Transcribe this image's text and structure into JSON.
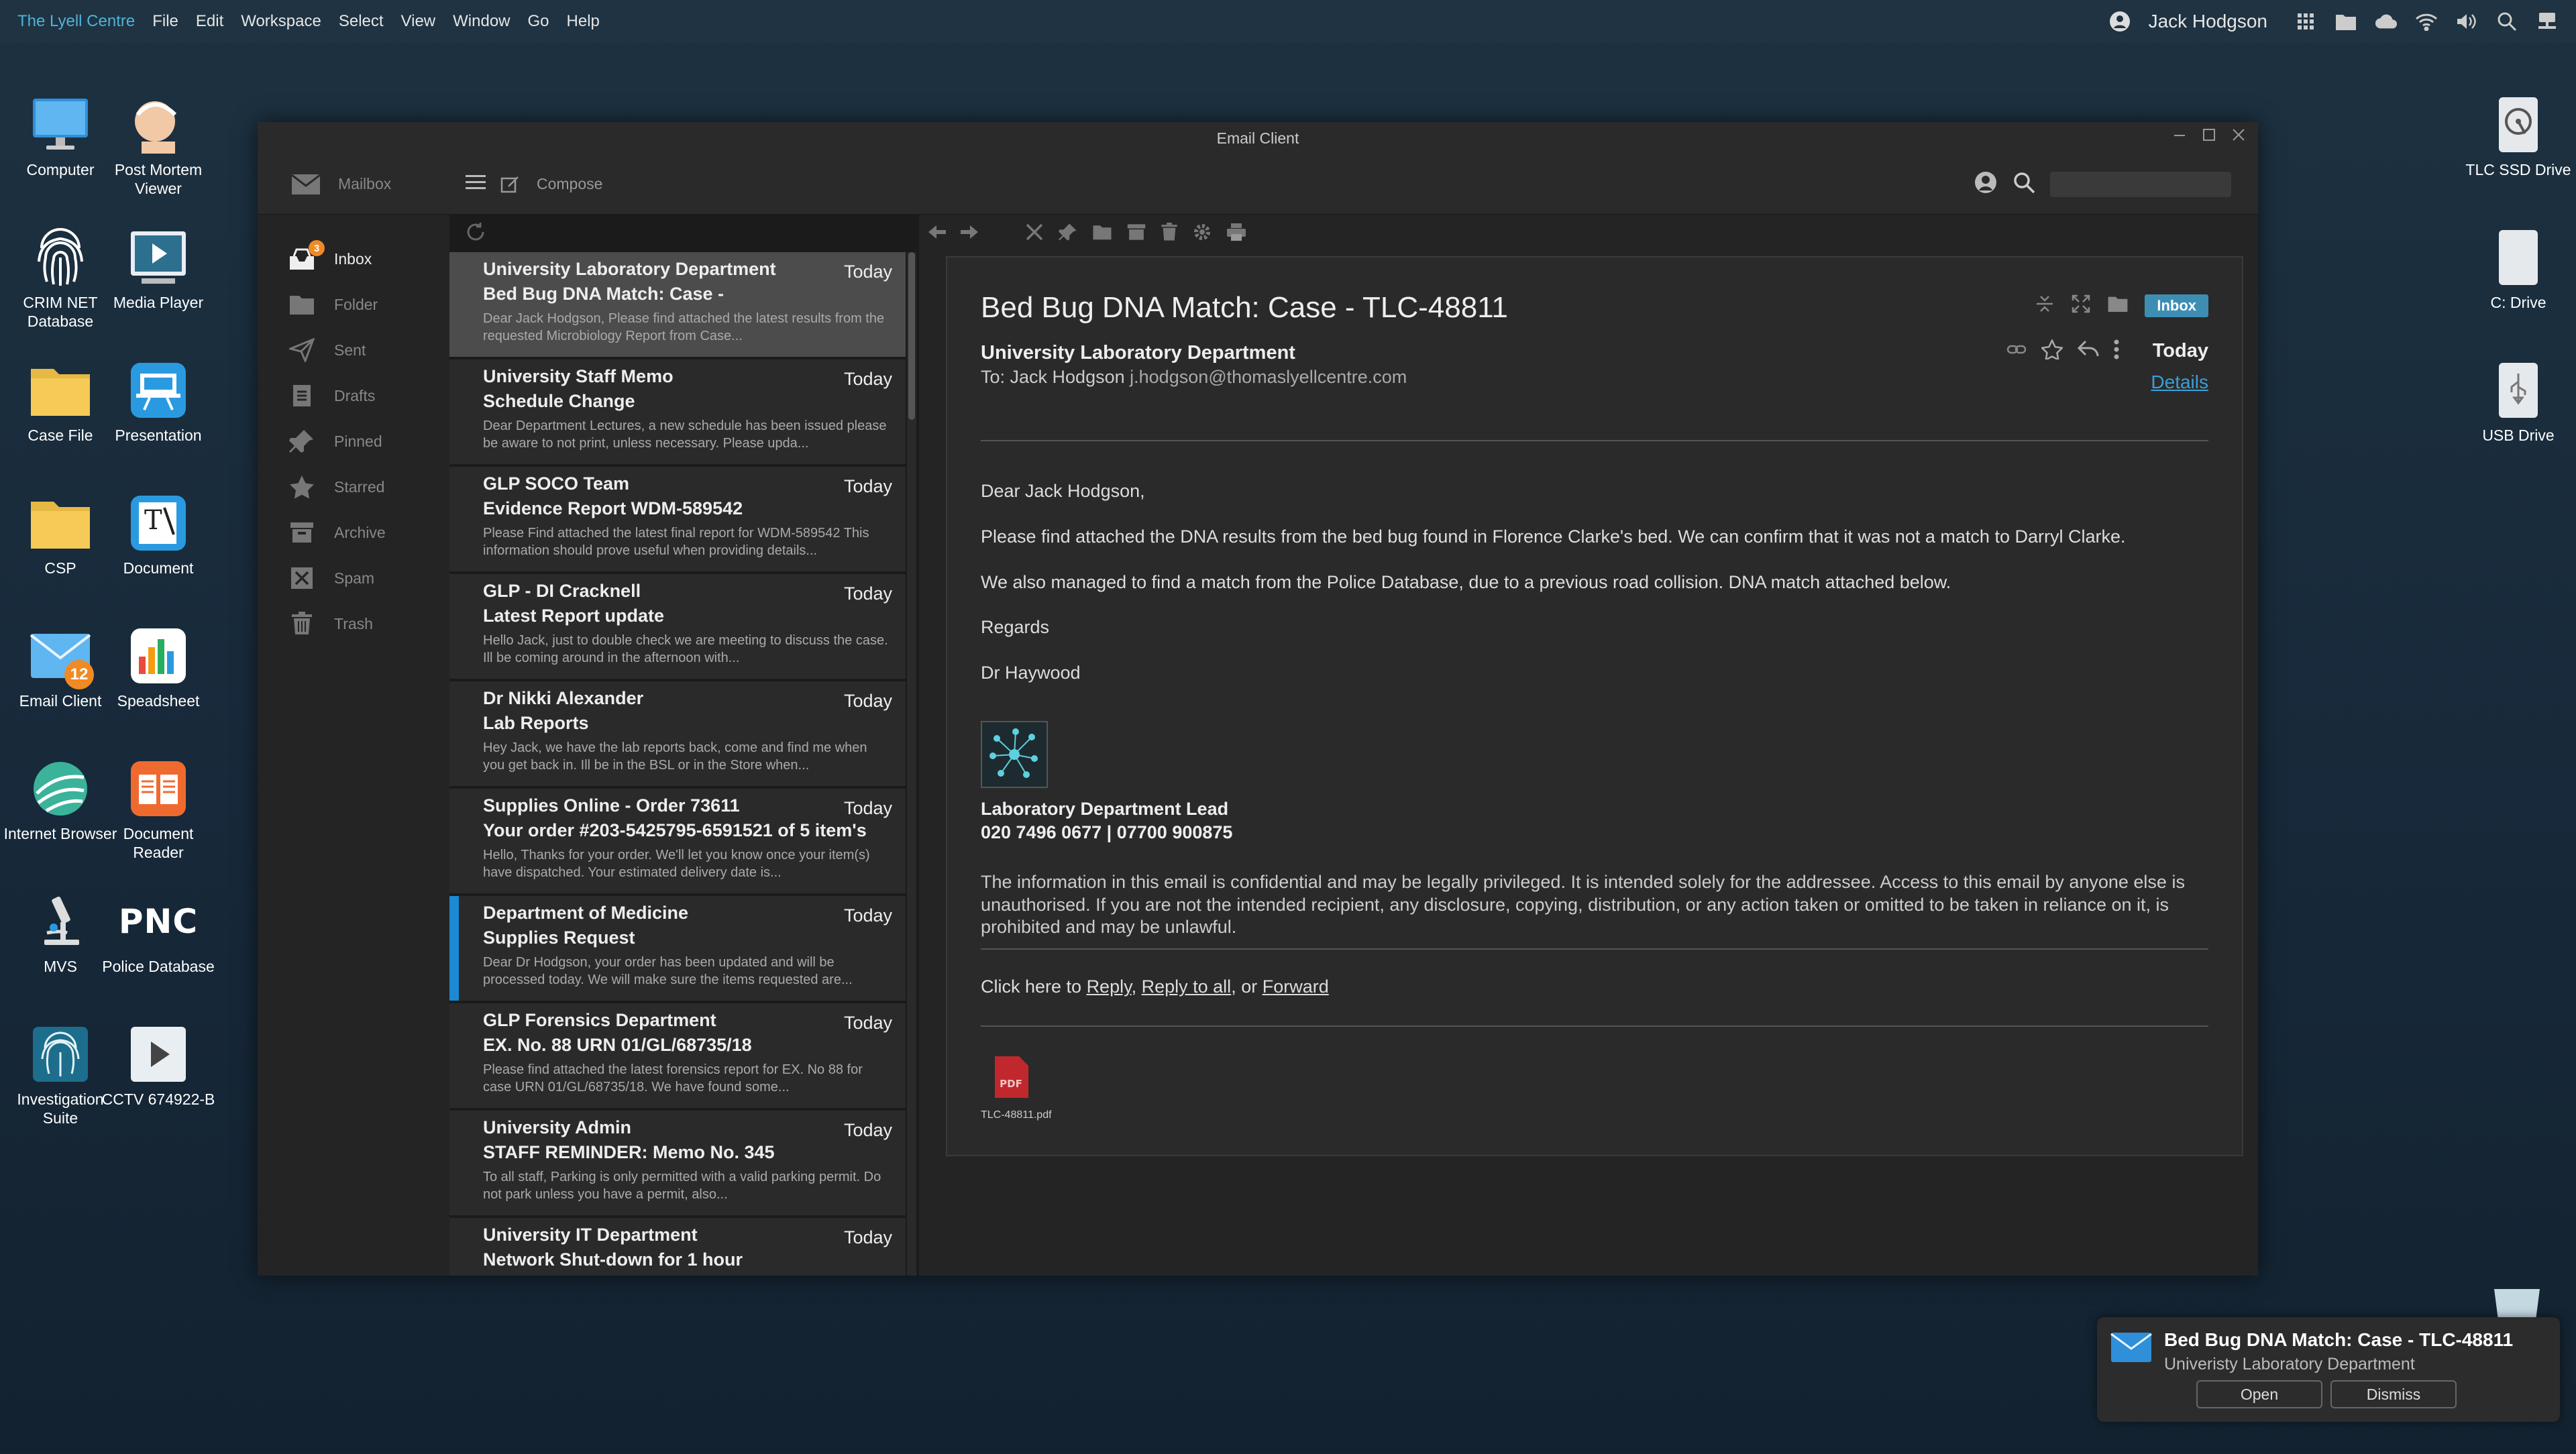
{
  "menubar": {
    "brand": "The Lyell Centre",
    "items": [
      "File",
      "Edit",
      "Workspace",
      "Select",
      "View",
      "Window",
      "Go",
      "Help"
    ],
    "user": "Jack Hodgson"
  },
  "desktop_left": [
    {
      "label": "Computer",
      "icon": "computer-icon"
    },
    {
      "label": "Post Mortem Viewer",
      "icon": "post-mortem-icon"
    },
    {
      "label": "CRIM NET Database",
      "icon": "fingerprint-icon"
    },
    {
      "label": "Media Player",
      "icon": "media-player-icon"
    },
    {
      "label": "Case File",
      "icon": "folder-icon"
    },
    {
      "label": "Presentation",
      "icon": "presentation-icon"
    },
    {
      "label": "CSP",
      "icon": "folder-icon"
    },
    {
      "label": "Document",
      "icon": "document-icon"
    },
    {
      "label": "Email Client",
      "icon": "email-icon",
      "badge": "12"
    },
    {
      "label": "Speadsheet",
      "icon": "spreadsheet-icon"
    },
    {
      "label": "Internet Browser",
      "icon": "browser-icon"
    },
    {
      "label": "Document Reader",
      "icon": "document-reader-icon"
    },
    {
      "label": "MVS",
      "icon": "microscope-icon"
    },
    {
      "label": "Police Database",
      "icon": "pnc-icon",
      "logo_text": "PNC"
    },
    {
      "label": "Investigation Suite",
      "icon": "fingerprint-icon"
    },
    {
      "label": "CCTV 674922-B",
      "icon": "cctv-icon"
    }
  ],
  "desktop_right": [
    {
      "label": "TLC SSD Drive",
      "icon": "ssd-drive-icon"
    },
    {
      "label": "C: Drive",
      "icon": "hard-drive-icon"
    },
    {
      "label": "USB Drive",
      "icon": "usb-drive-icon"
    }
  ],
  "window": {
    "title": "Email Client",
    "mailbox_label": "Mailbox",
    "compose_label": "Compose",
    "search_placeholder": ""
  },
  "sidebar": [
    {
      "label": "Inbox",
      "icon": "inbox-icon",
      "badge": "3",
      "active": true
    },
    {
      "label": "Folder",
      "icon": "folder-icon"
    },
    {
      "label": "Sent",
      "icon": "sent-icon"
    },
    {
      "label": "Drafts",
      "icon": "drafts-icon"
    },
    {
      "label": "Pinned",
      "icon": "pin-icon"
    },
    {
      "label": "Starred",
      "icon": "star-icon"
    },
    {
      "label": "Archive",
      "icon": "archive-icon"
    },
    {
      "label": "Spam",
      "icon": "spam-icon"
    },
    {
      "label": "Trash",
      "icon": "trash-icon"
    }
  ],
  "messages": [
    {
      "from": "University Laboratory Department",
      "date": "Today",
      "subject": "Bed Bug DNA Match: Case -",
      "preview": "Dear Jack Hodgson, Please find attached the latest results from the requested Microbiology Report from Case...",
      "selected": true
    },
    {
      "from": "University Staff Memo",
      "date": "Today",
      "subject": "Schedule Change",
      "preview": "Dear Department Lectures, a new schedule has been issued please be aware to not print, unless necessary. Please upda..."
    },
    {
      "from": "GLP SOCO Team",
      "date": "Today",
      "subject": "Evidence Report WDM-589542",
      "preview": "Please Find attached the latest final report for WDM-589542 This information should prove useful when providing details..."
    },
    {
      "from": "GLP - DI Cracknell",
      "date": "Today",
      "subject": "Latest Report update",
      "preview": "Hello Jack, just to double check we are meeting to discuss the case. Ill be coming around in the afternoon with..."
    },
    {
      "from": "Dr Nikki Alexander",
      "date": "Today",
      "subject": "Lab Reports",
      "preview": "Hey Jack, we have the lab reports back, come and find me when you get back in. Ill be in the BSL or in the Store when..."
    },
    {
      "from": "Supplies Online - Order 73611",
      "date": "Today",
      "subject": "Your order #203-5425795-6591521 of 5 item's",
      "preview": "Hello, Thanks for your order. We'll let you know once your item(s) have dispatched. Your estimated delivery date is..."
    },
    {
      "from": "Department of Medicine",
      "date": "Today",
      "subject": "Supplies Request",
      "preview": "Dear Dr Hodgson, your order has been updated and will be processed today. We will make sure the items requested are...",
      "marked": true
    },
    {
      "from": "GLP Forensics Department",
      "date": "Today",
      "subject": "EX. No. 88 URN 01/GL/68735/18",
      "preview": "Please find attached the latest forensics report for EX. No 88 for case URN 01/GL/68735/18. We have found some..."
    },
    {
      "from": "University Admin",
      "date": "Today",
      "subject": "STAFF REMINDER: Memo No. 345",
      "preview": "To all staff, Parking is only permitted with a valid parking permit. Do not park unless you have a permit, also..."
    },
    {
      "from": "University IT Department",
      "date": "Today",
      "subject": "Network Shut-down for 1 hour",
      "preview": ""
    }
  ],
  "reader": {
    "title": "Bed Bug DNA Match: Case - TLC-48811",
    "tag": "Inbox",
    "sender": "University Laboratory Department",
    "to_label": "To: Jack Hodgson",
    "to_address": "j.hodgson@thomaslyellcentre.com",
    "date": "Today",
    "details_link": "Details",
    "greeting": "Dear Jack Hodgson,",
    "p1": "Please find attached the DNA results from the bed bug found in Florence Clarke's bed. We can confirm that it was not a match to Darryl Clarke.",
    "p2": "We also managed to find a match from the Police Database, due to a previous road collision. DNA match attached below.",
    "regards": "Regards",
    "signoff": "Dr Haywood",
    "sig_title": "Laboratory Department Lead",
    "sig_phone": "020 7496 0677 | 07700 900875",
    "confidential": "The information in this email is confidential and may be legally privileged. It is intended solely for the addressee. Access to this email by anyone else is unauthorised. If you are not the intended recipient, any disclosure, copying, distribution, or any action taken or omitted to be taken in reliance on it, is prohibited and may be unlawful.",
    "click_prefix": "Click here to ",
    "reply": "Reply",
    "reply_all": "Reply to all",
    "or_text": ", or ",
    "forward": "Forward",
    "attachment_icon_text": "PDF",
    "attachment_name": "TLC-48811.pdf"
  },
  "notification": {
    "title": "Bed Bug DNA Match: Case - TLC-48811",
    "subtitle": "Univeristy Laboratory Department",
    "open": "Open",
    "dismiss": "Dismiss"
  }
}
